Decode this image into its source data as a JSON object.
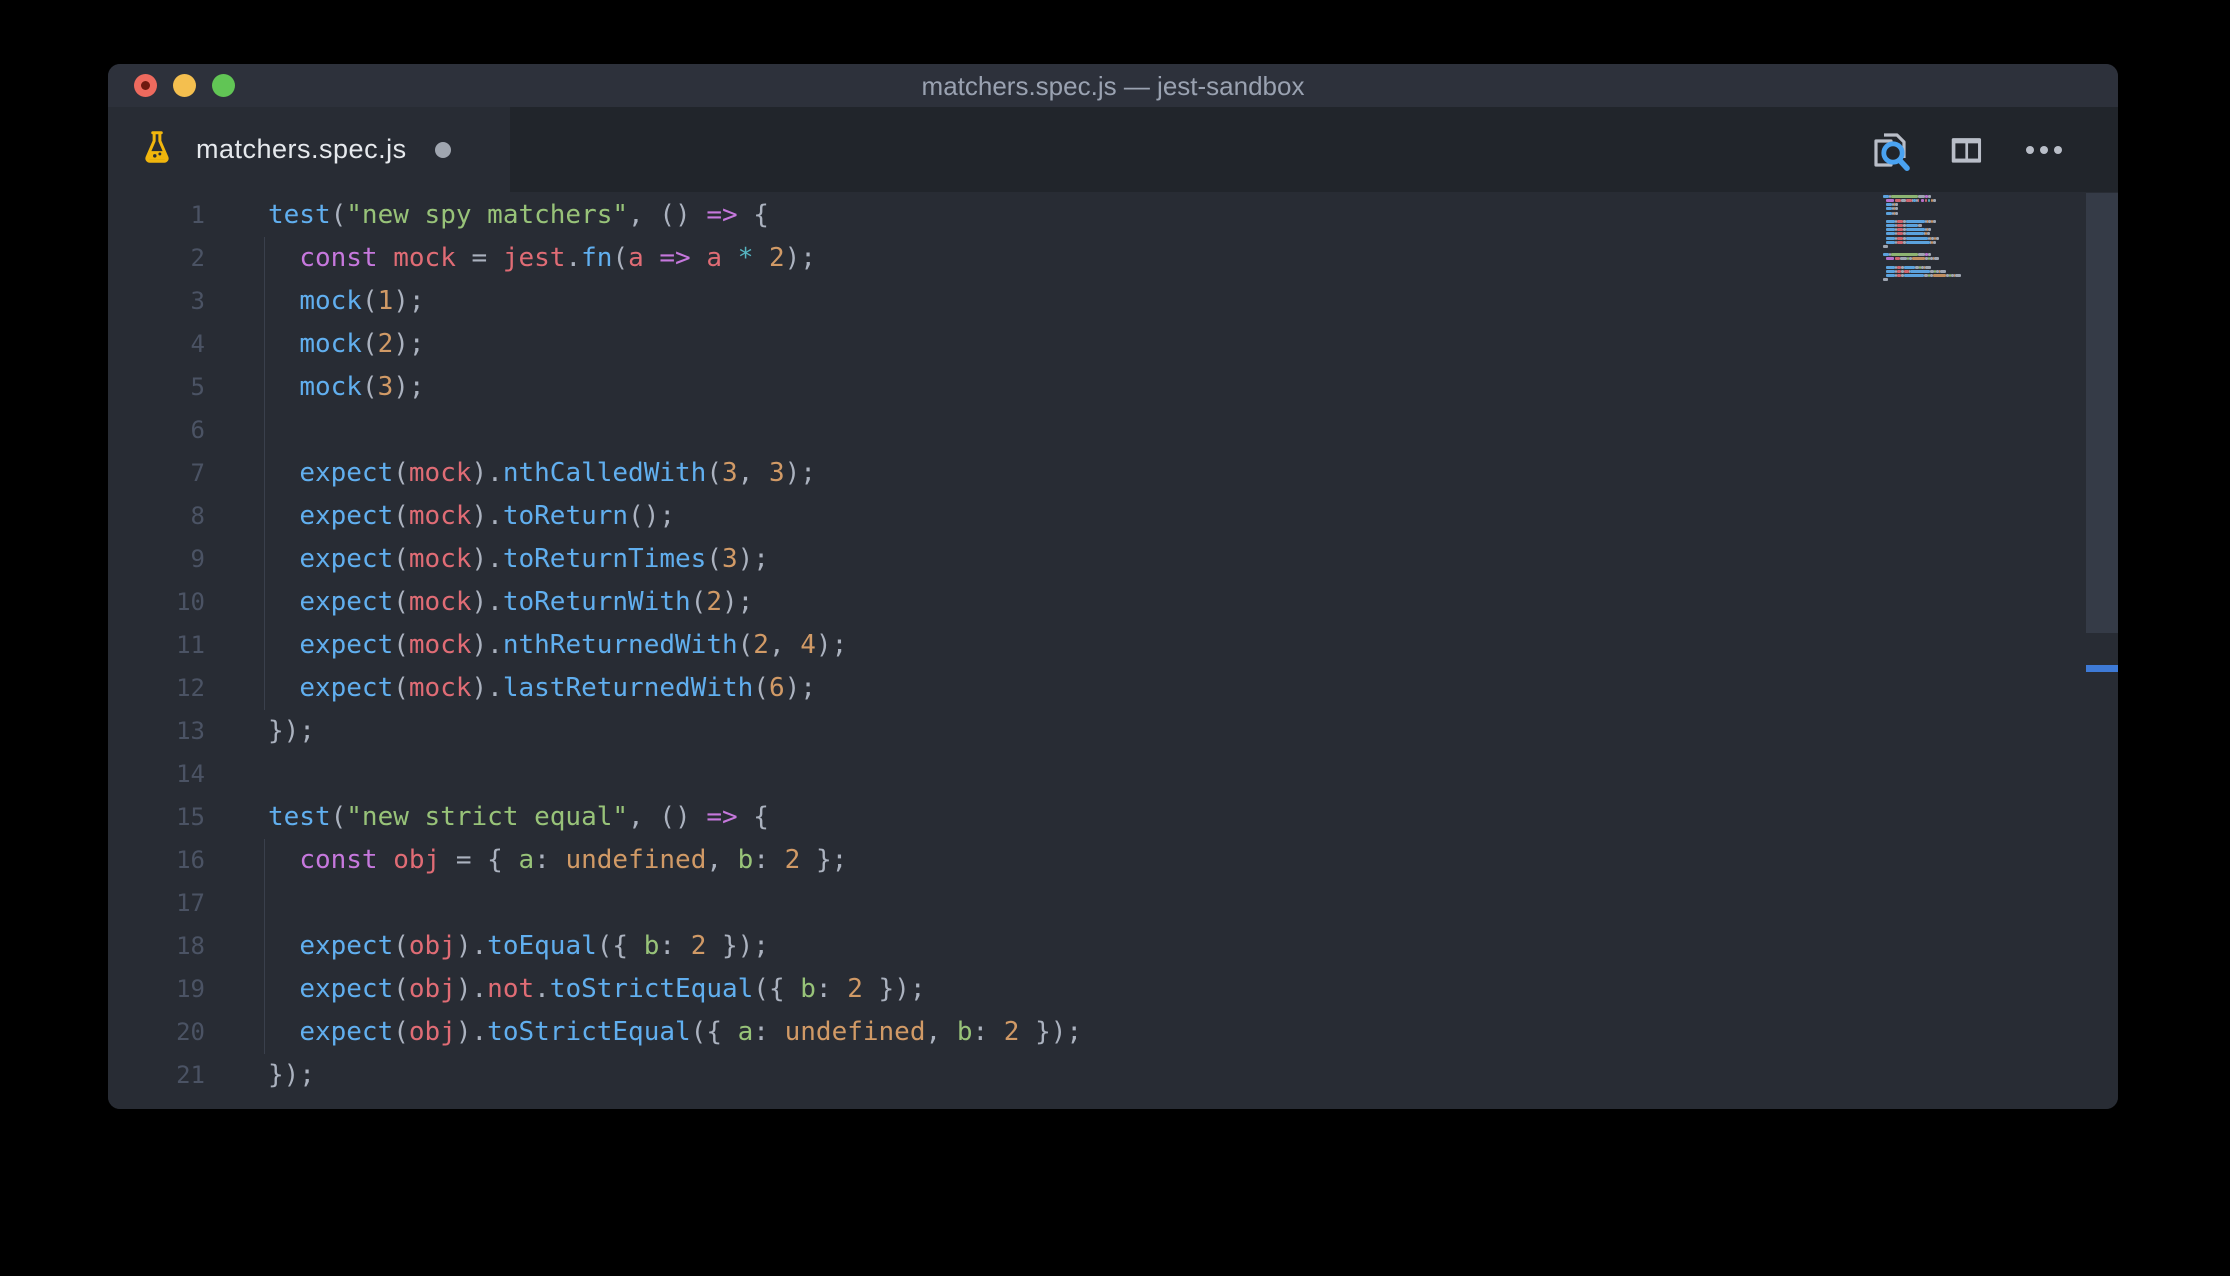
{
  "window": {
    "title": "matchers.spec.js — jest-sandbox"
  },
  "tab": {
    "label": "matchers.spec.js",
    "modified": true,
    "icon": "jest-flask-icon"
  },
  "actions": [
    {
      "name": "search-in-file"
    },
    {
      "name": "split-editor"
    },
    {
      "name": "more-actions"
    }
  ],
  "colors": {
    "accent_blue": "#3e7ad6",
    "traffic_red": "#ed6a5e",
    "traffic_yellow": "#f4bf4f",
    "traffic_green": "#61c555",
    "flask_gold": "#f1b60d",
    "icon_gray": "#b9bec8",
    "icon_blue": "#4aa3f2",
    "tokens": {
      "keyword": "#c678dd",
      "function": "#61afef",
      "variable": "#e06c75",
      "string": "#98c379",
      "number": "#d19a66",
      "punct": "#abb2bf",
      "operator": "#56b6c2"
    }
  },
  "editor": {
    "line_count": 21,
    "lines": [
      {
        "n": 1,
        "guide": false,
        "tokens": [
          [
            "test",
            "function"
          ],
          [
            "(",
            "punct"
          ],
          [
            "\"new spy matchers\"",
            "string"
          ],
          [
            ", () ",
            "punct"
          ],
          [
            "=>",
            "keyword"
          ],
          [
            " {",
            "punct"
          ]
        ]
      },
      {
        "n": 2,
        "guide": true,
        "tokens": [
          [
            "  ",
            "punct"
          ],
          [
            "const",
            "keyword"
          ],
          [
            " ",
            "punct"
          ],
          [
            "mock",
            "variable"
          ],
          [
            " = ",
            "punct"
          ],
          [
            "jest",
            "variable"
          ],
          [
            ".",
            "punct"
          ],
          [
            "fn",
            "function"
          ],
          [
            "(",
            "punct"
          ],
          [
            "a",
            "variable"
          ],
          [
            " ",
            "punct"
          ],
          [
            "=>",
            "keyword"
          ],
          [
            " ",
            "punct"
          ],
          [
            "a",
            "variable"
          ],
          [
            " ",
            "punct"
          ],
          [
            "*",
            "operator"
          ],
          [
            " ",
            "punct"
          ],
          [
            "2",
            "number"
          ],
          [
            ");",
            "punct"
          ]
        ]
      },
      {
        "n": 3,
        "guide": true,
        "tokens": [
          [
            "  ",
            "punct"
          ],
          [
            "mock",
            "function"
          ],
          [
            "(",
            "punct"
          ],
          [
            "1",
            "number"
          ],
          [
            ");",
            "punct"
          ]
        ]
      },
      {
        "n": 4,
        "guide": true,
        "tokens": [
          [
            "  ",
            "punct"
          ],
          [
            "mock",
            "function"
          ],
          [
            "(",
            "punct"
          ],
          [
            "2",
            "number"
          ],
          [
            ");",
            "punct"
          ]
        ]
      },
      {
        "n": 5,
        "guide": true,
        "tokens": [
          [
            "  ",
            "punct"
          ],
          [
            "mock",
            "function"
          ],
          [
            "(",
            "punct"
          ],
          [
            "3",
            "number"
          ],
          [
            ");",
            "punct"
          ]
        ]
      },
      {
        "n": 6,
        "guide": true,
        "tokens": []
      },
      {
        "n": 7,
        "guide": true,
        "tokens": [
          [
            "  ",
            "punct"
          ],
          [
            "expect",
            "function"
          ],
          [
            "(",
            "punct"
          ],
          [
            "mock",
            "variable"
          ],
          [
            ").",
            "punct"
          ],
          [
            "nthCalledWith",
            "function"
          ],
          [
            "(",
            "punct"
          ],
          [
            "3",
            "number"
          ],
          [
            ", ",
            "punct"
          ],
          [
            "3",
            "number"
          ],
          [
            ");",
            "punct"
          ]
        ]
      },
      {
        "n": 8,
        "guide": true,
        "tokens": [
          [
            "  ",
            "punct"
          ],
          [
            "expect",
            "function"
          ],
          [
            "(",
            "punct"
          ],
          [
            "mock",
            "variable"
          ],
          [
            ").",
            "punct"
          ],
          [
            "toReturn",
            "function"
          ],
          [
            "();",
            "punct"
          ]
        ]
      },
      {
        "n": 9,
        "guide": true,
        "tokens": [
          [
            "  ",
            "punct"
          ],
          [
            "expect",
            "function"
          ],
          [
            "(",
            "punct"
          ],
          [
            "mock",
            "variable"
          ],
          [
            ").",
            "punct"
          ],
          [
            "toReturnTimes",
            "function"
          ],
          [
            "(",
            "punct"
          ],
          [
            "3",
            "number"
          ],
          [
            ");",
            "punct"
          ]
        ]
      },
      {
        "n": 10,
        "guide": true,
        "tokens": [
          [
            "  ",
            "punct"
          ],
          [
            "expect",
            "function"
          ],
          [
            "(",
            "punct"
          ],
          [
            "mock",
            "variable"
          ],
          [
            ").",
            "punct"
          ],
          [
            "toReturnWith",
            "function"
          ],
          [
            "(",
            "punct"
          ],
          [
            "2",
            "number"
          ],
          [
            ");",
            "punct"
          ]
        ]
      },
      {
        "n": 11,
        "guide": true,
        "tokens": [
          [
            "  ",
            "punct"
          ],
          [
            "expect",
            "function"
          ],
          [
            "(",
            "punct"
          ],
          [
            "mock",
            "variable"
          ],
          [
            ").",
            "punct"
          ],
          [
            "nthReturnedWith",
            "function"
          ],
          [
            "(",
            "punct"
          ],
          [
            "2",
            "number"
          ],
          [
            ", ",
            "punct"
          ],
          [
            "4",
            "number"
          ],
          [
            ");",
            "punct"
          ]
        ]
      },
      {
        "n": 12,
        "guide": true,
        "tokens": [
          [
            "  ",
            "punct"
          ],
          [
            "expect",
            "function"
          ],
          [
            "(",
            "punct"
          ],
          [
            "mock",
            "variable"
          ],
          [
            ").",
            "punct"
          ],
          [
            "lastReturnedWith",
            "function"
          ],
          [
            "(",
            "punct"
          ],
          [
            "6",
            "number"
          ],
          [
            ");",
            "punct"
          ]
        ]
      },
      {
        "n": 13,
        "guide": false,
        "tokens": [
          [
            "});",
            "punct"
          ]
        ]
      },
      {
        "n": 14,
        "guide": false,
        "tokens": []
      },
      {
        "n": 15,
        "guide": false,
        "tokens": [
          [
            "test",
            "function"
          ],
          [
            "(",
            "punct"
          ],
          [
            "\"new strict equal\"",
            "string"
          ],
          [
            ", () ",
            "punct"
          ],
          [
            "=>",
            "keyword"
          ],
          [
            " {",
            "punct"
          ]
        ]
      },
      {
        "n": 16,
        "guide": true,
        "tokens": [
          [
            "  ",
            "punct"
          ],
          [
            "const",
            "keyword"
          ],
          [
            " ",
            "punct"
          ],
          [
            "obj",
            "variable"
          ],
          [
            " = { ",
            "punct"
          ],
          [
            "a",
            "string"
          ],
          [
            ": ",
            "punct"
          ],
          [
            "undefined",
            "number"
          ],
          [
            ", ",
            "punct"
          ],
          [
            "b",
            "string"
          ],
          [
            ": ",
            "punct"
          ],
          [
            "2",
            "number"
          ],
          [
            " };",
            "punct"
          ]
        ]
      },
      {
        "n": 17,
        "guide": true,
        "tokens": []
      },
      {
        "n": 18,
        "guide": true,
        "tokens": [
          [
            "  ",
            "punct"
          ],
          [
            "expect",
            "function"
          ],
          [
            "(",
            "punct"
          ],
          [
            "obj",
            "variable"
          ],
          [
            ").",
            "punct"
          ],
          [
            "toEqual",
            "function"
          ],
          [
            "({ ",
            "punct"
          ],
          [
            "b",
            "string"
          ],
          [
            ": ",
            "punct"
          ],
          [
            "2",
            "number"
          ],
          [
            " });",
            "punct"
          ]
        ]
      },
      {
        "n": 19,
        "guide": true,
        "tokens": [
          [
            "  ",
            "punct"
          ],
          [
            "expect",
            "function"
          ],
          [
            "(",
            "punct"
          ],
          [
            "obj",
            "variable"
          ],
          [
            ").",
            "punct"
          ],
          [
            "not",
            "variable"
          ],
          [
            ".",
            "punct"
          ],
          [
            "toStrictEqual",
            "function"
          ],
          [
            "({ ",
            "punct"
          ],
          [
            "b",
            "string"
          ],
          [
            ": ",
            "punct"
          ],
          [
            "2",
            "number"
          ],
          [
            " });",
            "punct"
          ]
        ]
      },
      {
        "n": 20,
        "guide": true,
        "tokens": [
          [
            "  ",
            "punct"
          ],
          [
            "expect",
            "function"
          ],
          [
            "(",
            "punct"
          ],
          [
            "obj",
            "variable"
          ],
          [
            ").",
            "punct"
          ],
          [
            "toStrictEqual",
            "function"
          ],
          [
            "({ ",
            "punct"
          ],
          [
            "a",
            "string"
          ],
          [
            ": ",
            "punct"
          ],
          [
            "undefined",
            "number"
          ],
          [
            ", ",
            "punct"
          ],
          [
            "b",
            "string"
          ],
          [
            ": ",
            "punct"
          ],
          [
            "2",
            "number"
          ],
          [
            " });",
            "punct"
          ]
        ]
      },
      {
        "n": 21,
        "guide": false,
        "tokens": [
          [
            "});",
            "punct"
          ]
        ]
      }
    ]
  }
}
